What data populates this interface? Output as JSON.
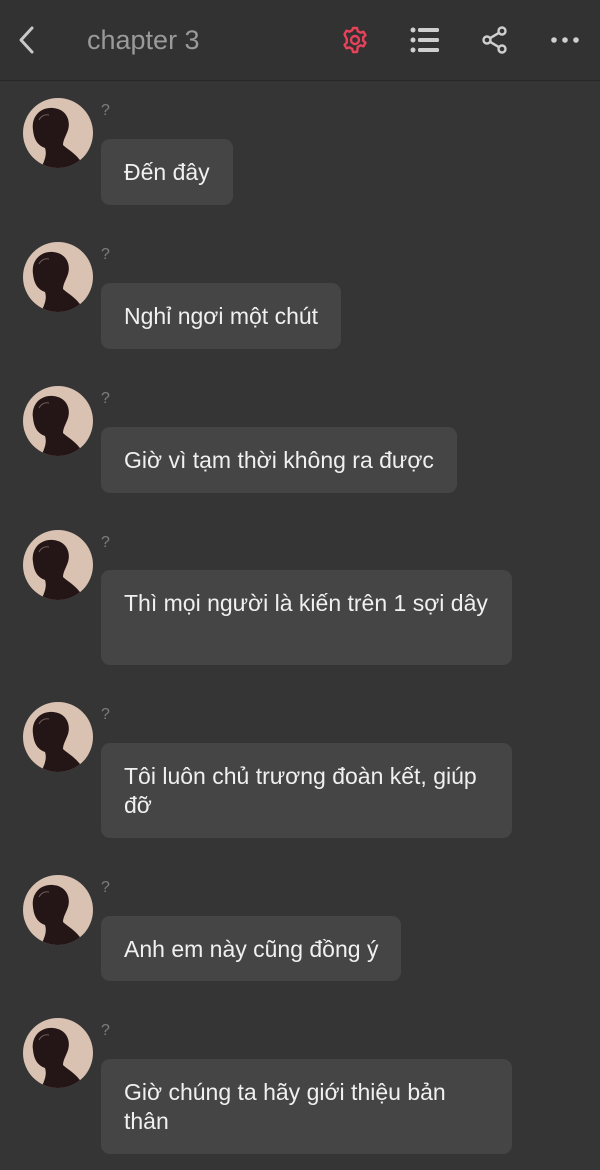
{
  "header": {
    "title": "chapter 3",
    "icons": [
      "back-chevron-icon",
      "settings-gear-icon",
      "list-icon",
      "share-icon",
      "more-icon"
    ],
    "accent_color": "#e8415a"
  },
  "messages": [
    {
      "sender": "?",
      "text": "Đến đây"
    },
    {
      "sender": "?",
      "text": "Nghỉ ngơi một chút"
    },
    {
      "sender": "?",
      "text": "Giờ vì tạm thời không ra được"
    },
    {
      "sender": "?",
      "text": "Thì mọi người là kiến trên 1 sợi dây"
    },
    {
      "sender": "?",
      "text": "Tôi luôn chủ trương đoàn kết, giúp đỡ"
    },
    {
      "sender": "?",
      "text": "Anh em này cũng đồng ý"
    },
    {
      "sender": "?",
      "text": "Giờ chúng ta hãy giới thiệu bản thân"
    }
  ]
}
